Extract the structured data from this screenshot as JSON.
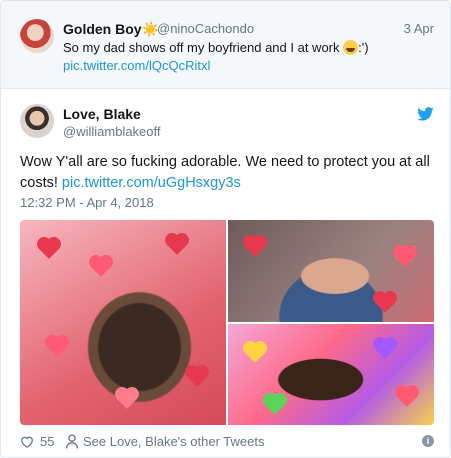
{
  "quoted": {
    "name": "Golden Boy",
    "name_emoji": "☀️",
    "handle": "@ninoCachondo",
    "date": "3 Apr",
    "text": "So my dad shows off my boyfriend and I at work ",
    "text_suffix": ":')",
    "link": "pic.twitter.com/lQcQcRitxl"
  },
  "tweet": {
    "name": "Love, Blake",
    "handle": "@williamblakeoff",
    "text": "Wow Y'all are so fucking adorable. We need to protect you at all costs! ",
    "link": "pic.twitter.com/uGgHsxgy3s",
    "timestamp": "12:32 PM - Apr 4, 2018"
  },
  "footer": {
    "likes": "55",
    "other_tweets": "See Love, Blake's other Tweets"
  },
  "icons": {
    "platform": "twitter-bird-icon",
    "like": "heart-icon",
    "profile": "person-icon",
    "info": "info-icon"
  },
  "colors": {
    "link": "#1b95e0",
    "muted": "#657786",
    "bird": "#1da1f2"
  }
}
